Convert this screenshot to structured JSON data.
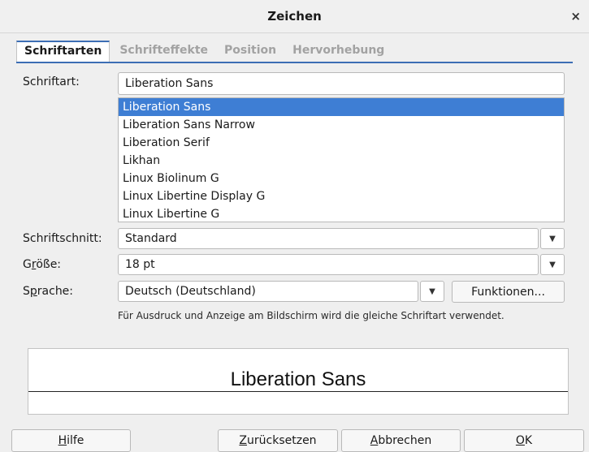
{
  "window": {
    "title": "Zeichen",
    "close_glyph": "×"
  },
  "tabs": [
    {
      "label": "Schriftarten",
      "active": true
    },
    {
      "label": "Schrifteffekte"
    },
    {
      "label": "Position"
    },
    {
      "label": "Hervorhebung"
    }
  ],
  "font": {
    "label": "Schriftart:",
    "value": "Liberation Sans",
    "list": [
      "Liberation Sans",
      "Liberation Sans Narrow",
      "Liberation Serif",
      "Likhan",
      "Linux Biolinum G",
      "Linux Libertine Display G",
      "Linux Libertine G"
    ],
    "selected_index": 0
  },
  "style": {
    "label": "Schriftschnitt:",
    "value": "Standard"
  },
  "size": {
    "label_a": "G",
    "label_mn": "r",
    "label_b": "öße:",
    "value": "18 pt"
  },
  "language": {
    "label_a": "S",
    "label_mn": "p",
    "label_b": "rache:",
    "value": "Deutsch (Deutschland)"
  },
  "features_button": "Funktionen...",
  "note": "Für Ausdruck und Anzeige am Bildschirm wird die gleiche Schriftart verwendet.",
  "preview": {
    "text": "Liberation Sans"
  },
  "buttons": {
    "help": {
      "mn": "H",
      "rest": "ilfe"
    },
    "reset": {
      "mn": "Z",
      "rest": "urücksetzen"
    },
    "cancel": {
      "mn": "A",
      "rest": "bbrechen"
    },
    "ok": {
      "mn": "O",
      "rest": "K"
    }
  },
  "colors": {
    "accent": "#3c6eb4",
    "selection": "#3e7ed4"
  },
  "icons": {
    "close": "close-icon",
    "dropdown": "chevron-down-icon"
  }
}
